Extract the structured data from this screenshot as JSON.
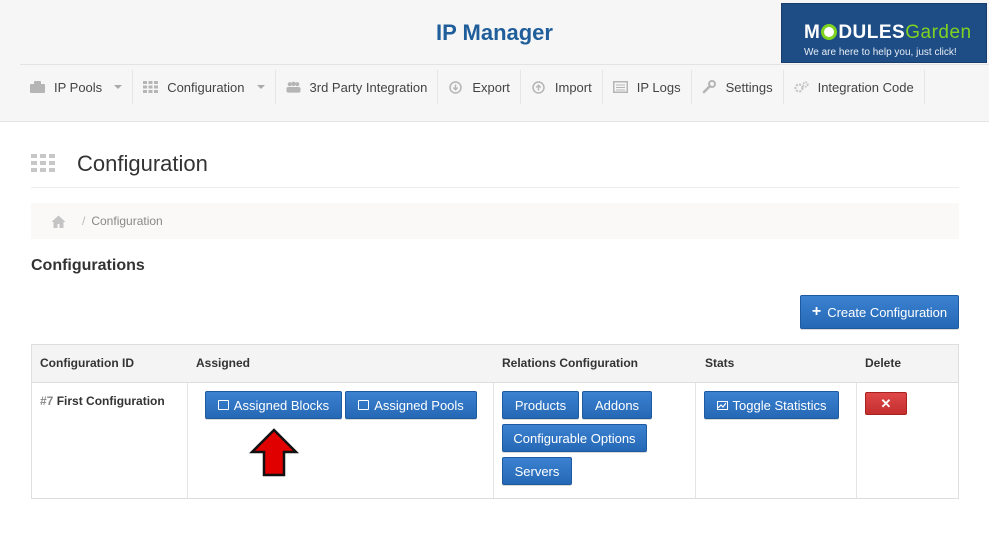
{
  "header": {
    "title": "IP Manager",
    "logo": {
      "brand_main": "M",
      "brand_rest": "DULES",
      "brand_accent": "Garden",
      "tagline": "We are here to help you, just click!"
    }
  },
  "nav": {
    "items": [
      {
        "label": "IP Pools",
        "icon": "server-icon",
        "dropdown": true
      },
      {
        "label": "Configuration",
        "icon": "grid-icon",
        "dropdown": true
      },
      {
        "label": "3rd Party Integration",
        "icon": "group-icon",
        "dropdown": false
      },
      {
        "label": "Export",
        "icon": "download-icon",
        "dropdown": false
      },
      {
        "label": "Import",
        "icon": "upload-icon",
        "dropdown": false
      },
      {
        "label": "IP Logs",
        "icon": "list-icon",
        "dropdown": false
      },
      {
        "label": "Settings",
        "icon": "wrench-icon",
        "dropdown": false
      },
      {
        "label": "Integration Code",
        "icon": "cogs-icon",
        "dropdown": false
      }
    ]
  },
  "page": {
    "title": "Configuration",
    "breadcrumb": {
      "separator": "/",
      "current": "Configuration"
    },
    "section_title": "Configurations",
    "create_button": "Create Configuration"
  },
  "table": {
    "headers": [
      "Configuration ID",
      "Assigned",
      "Relations Configuration",
      "Stats",
      "Delete"
    ],
    "rows": [
      {
        "id": "#7",
        "name": "First Configuration",
        "assigned_blocks": "Assigned Blocks",
        "assigned_pools": "Assigned Pools",
        "products": "Products",
        "addons": "Addons",
        "configurable_options": "Configurable Options",
        "servers": "Servers",
        "toggle_statistics": "Toggle Statistics",
        "delete_symbol": "✕"
      }
    ]
  },
  "colors": {
    "accent": "#1f5e9b",
    "button_blue": "#2a6fbf",
    "button_red": "#d03a3a",
    "arrow": "#e00000"
  }
}
